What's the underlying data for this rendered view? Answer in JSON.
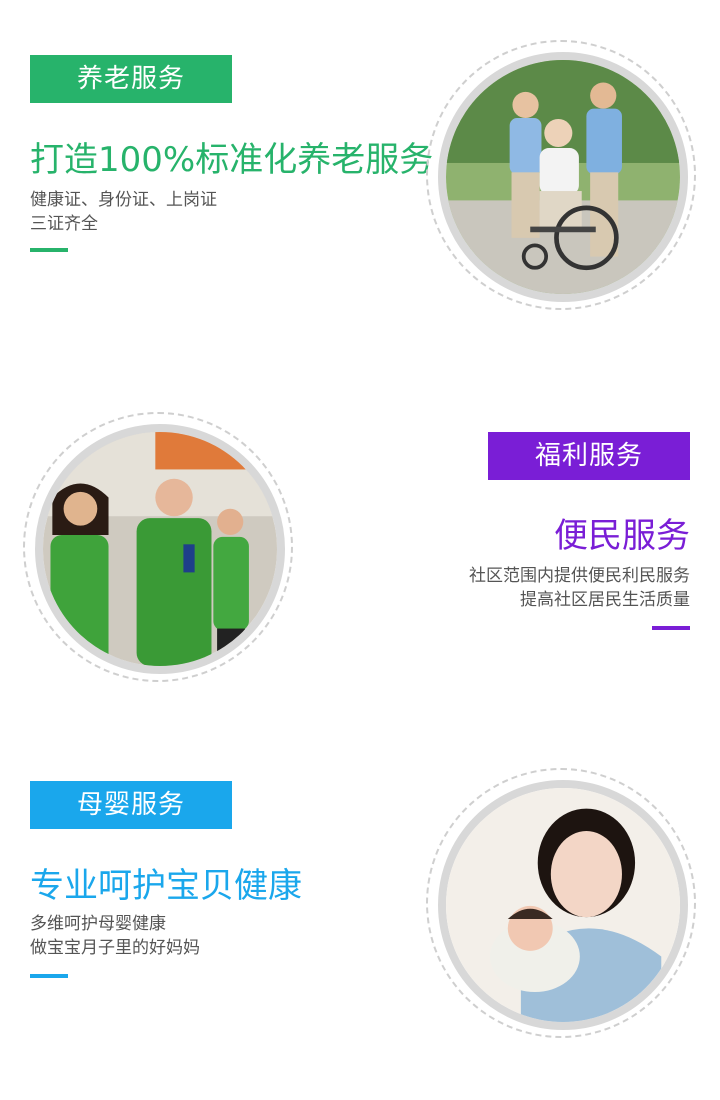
{
  "sections": [
    {
      "badge": "养老服务",
      "headline": "打造100%标准化养老服务",
      "lines": [
        "健康证、身份证、上岗证",
        "三证齐全"
      ],
      "accent": "#27b36b"
    },
    {
      "badge": "福利服务",
      "headline": "便民服务",
      "lines": [
        "社区范围内提供便民利民服务",
        "提高社区居民生活质量"
      ],
      "accent": "#7a1ed6"
    },
    {
      "badge": "母婴服务",
      "headline": "专业呵护宝贝健康",
      "lines": [
        "多维呵护母婴健康",
        "做宝宝月子里的好妈妈"
      ],
      "accent": "#1aa7ec"
    }
  ]
}
